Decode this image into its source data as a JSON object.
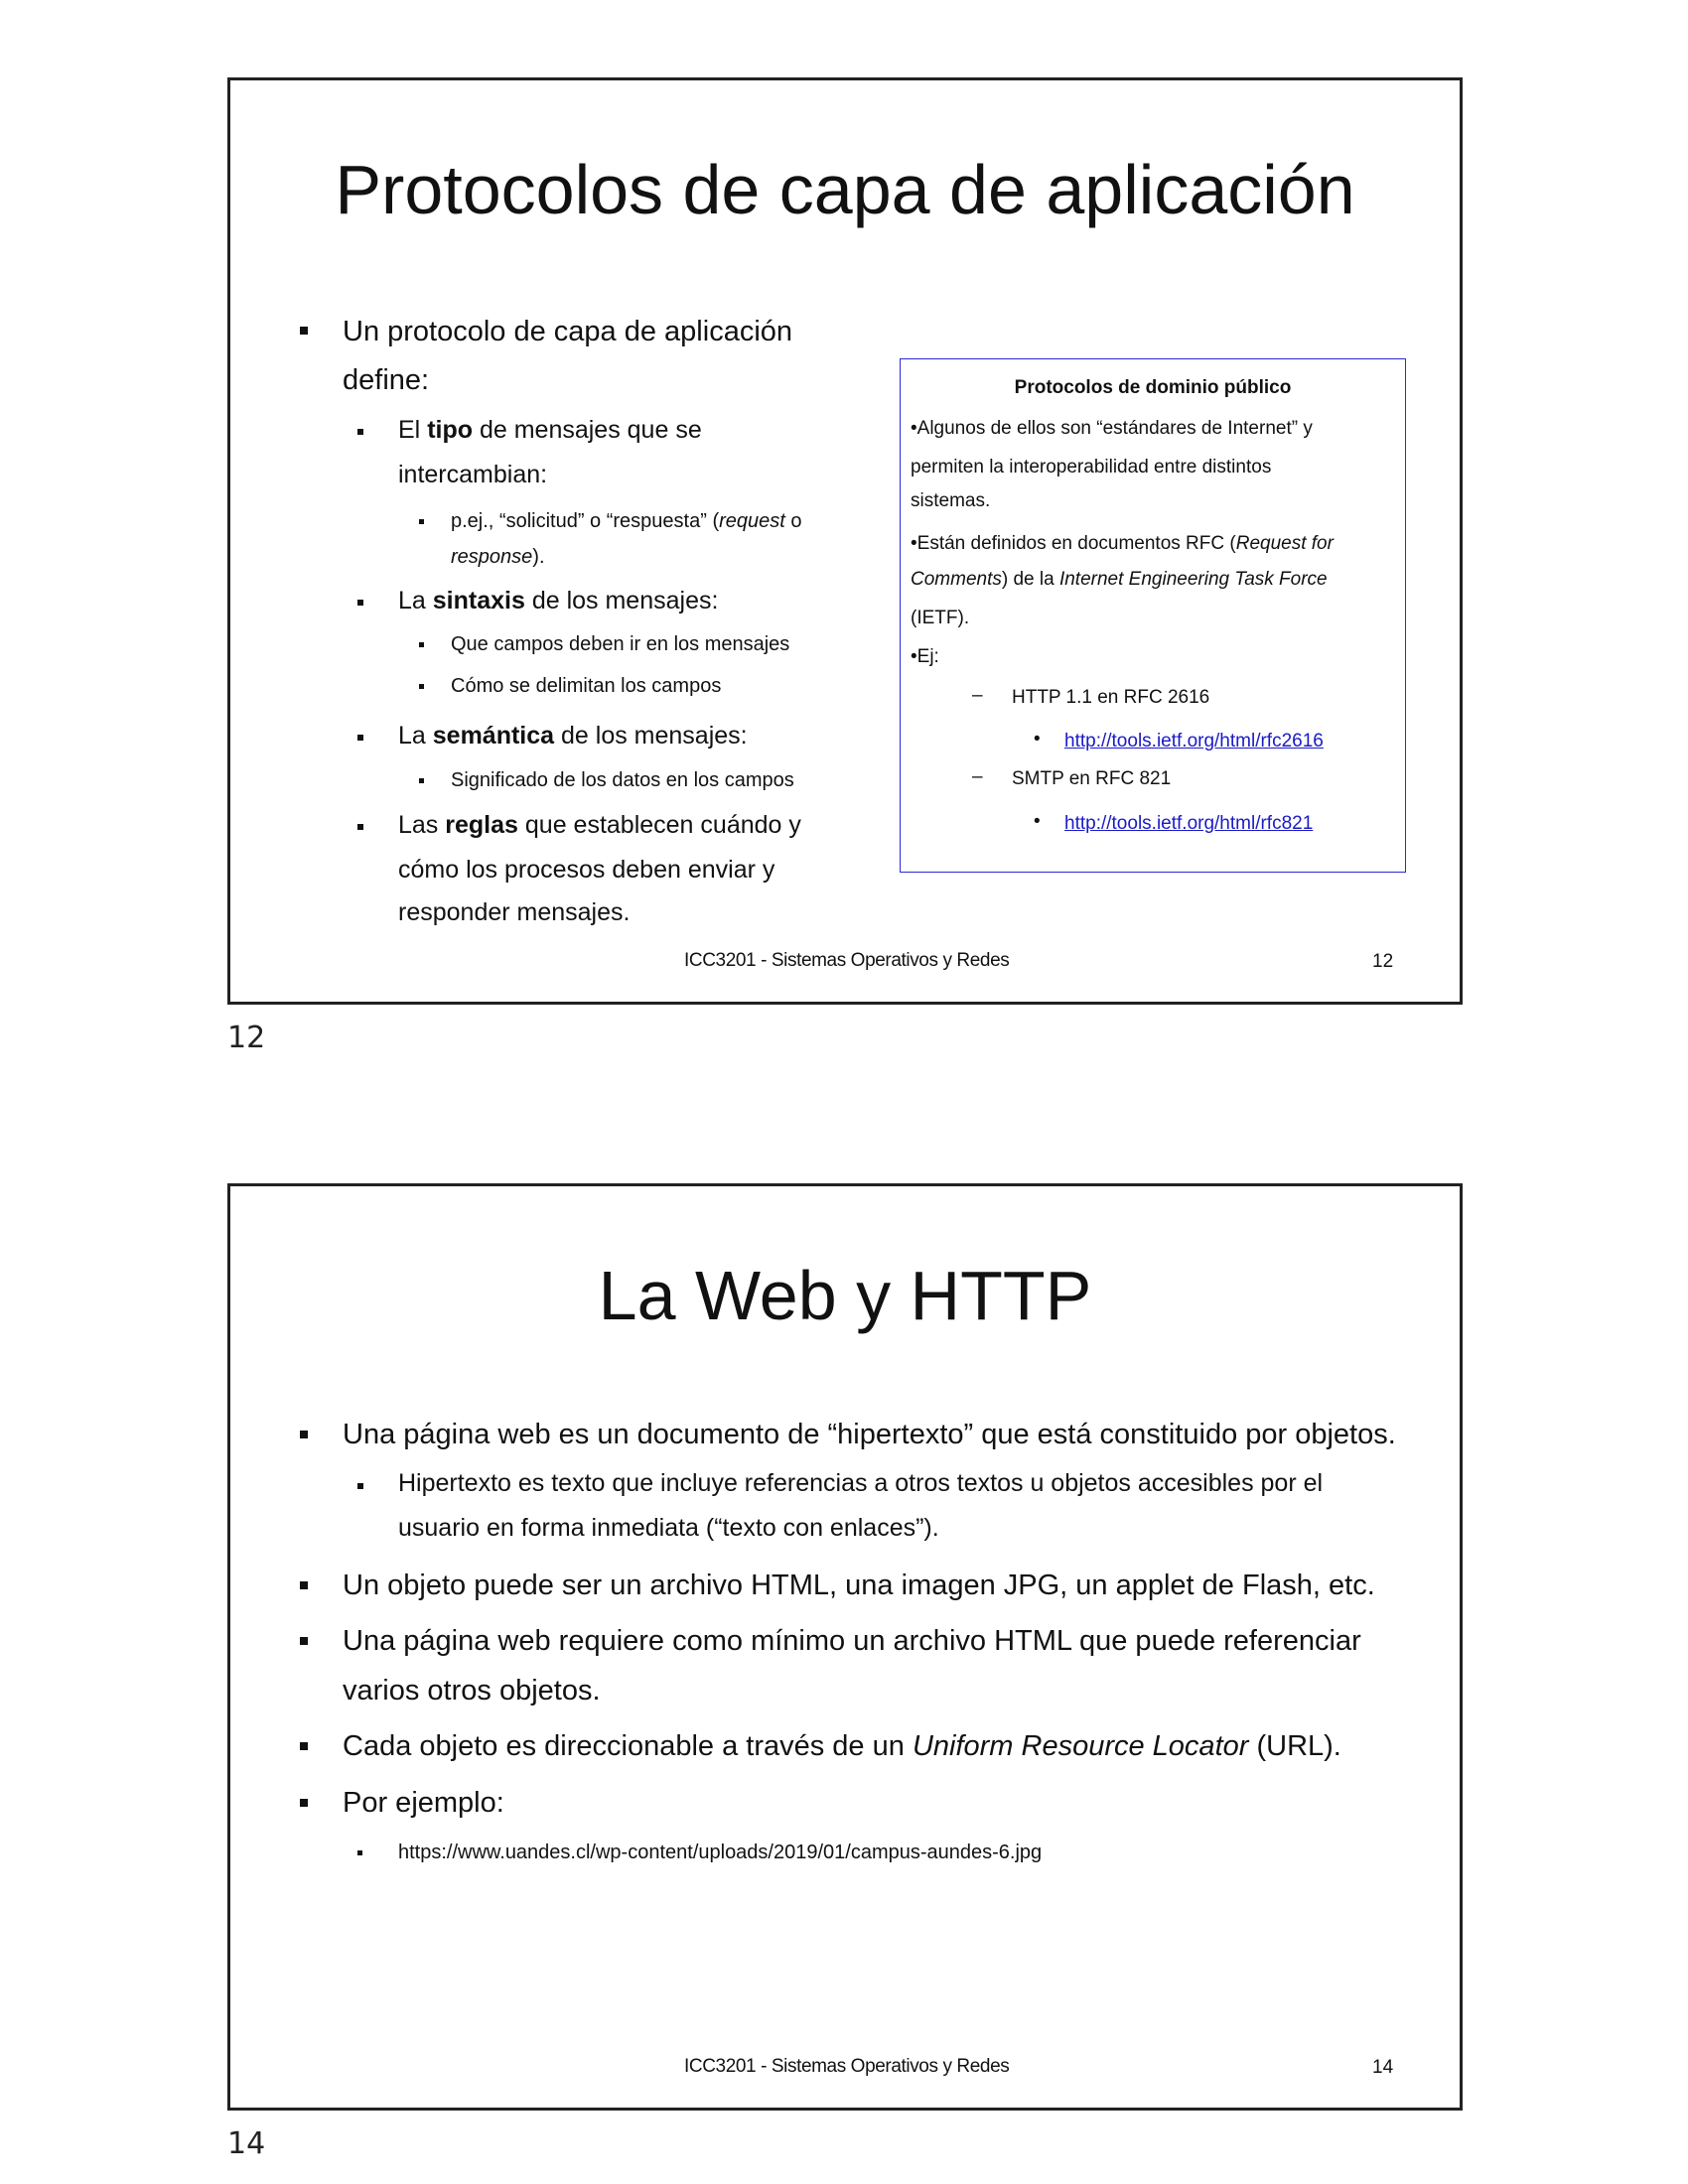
{
  "slide1": {
    "title": "Protocolos de capa de aplicación",
    "intro_line1": "Un protocolo de capa de aplicación",
    "intro_line2": "define:",
    "b1_pre": "El ",
    "b1_bold": "tipo",
    "b1_post": " de mensajes que se",
    "b1_line2": "intercambian:",
    "b1_sub_pre": "p.ej., “solicitud” o  “respuesta” (",
    "b1_sub_it": "request",
    "b1_sub_post": " o",
    "b1_sub_line2_it": "response",
    "b1_sub_line2_post": ").",
    "b2_pre": "La ",
    "b2_bold": "sintaxis",
    "b2_post": " de los mensajes:",
    "b2_sub1": "Que campos deben ir en los mensajes",
    "b2_sub2": "Cómo se delimitan los campos",
    "b3_pre": "La ",
    "b3_bold": "semántica",
    "b3_post": " de los mensajes:",
    "b3_sub1": "Significado de los datos en los campos",
    "b4_pre": "Las ",
    "b4_bold": "reglas",
    "b4_post": " que establecen cuándo y",
    "b4_line2": "cómo los procesos deben enviar y",
    "b4_line3": "responder mensajes.",
    "footer": "ICC3201 - Sistemas Operativos y Redes",
    "slide_number": "12",
    "page_number": "12",
    "box": {
      "heading": "Protocolos de dominio público",
      "line1": "•Algunos de ellos son “estándares de Internet” y",
      "line2": "permiten la interoperabilidad entre distintos",
      "line3": "sistemas.",
      "line4_pre": "•Están definidos en documentos RFC (",
      "line4_it": "Request for",
      "line5_it1": "Comments",
      "line5_mid": ") de la ",
      "line5_it2": "Internet Engineering Task Force",
      "line6": "(IETF).",
      "line7": "•Ej:",
      "dash": "–",
      "dot": "•",
      "ex1": "HTTP 1.1 en RFC 2616",
      "ex1_link": "http://tools.ietf.org/html/rfc2616",
      "ex2": "SMTP en RFC 821",
      "ex2_link": "http://tools.ietf.org/html/rfc821"
    }
  },
  "slide2": {
    "title": "La Web y HTTP",
    "b1": "Una página web es un documento de “hipertexto” que está constituido por objetos.",
    "b1_sub_line1": "Hipertexto es texto que incluye referencias a otros textos u objetos accesibles por el",
    "b1_sub_line2": "usuario en forma inmediata (“texto con enlaces”).",
    "b2": "Un objeto puede ser un archivo HTML, una imagen JPG, un applet de Flash, etc.",
    "b3_line1": "Una página web requiere como mínimo un archivo HTML que puede referenciar",
    "b3_line2": "varios otros objetos.",
    "b4_pre": "Cada objeto es direccionable a través de un ",
    "b4_it": "Uniform Resource Locator",
    "b4_post": " (URL).",
    "b5": "Por ejemplo:",
    "b5_sub": "https://www.uandes.cl/wp-content/uploads/2019/01/campus-aundes-6.jpg",
    "footer": "ICC3201 - Sistemas Operativos y Redes",
    "slide_number": "14",
    "page_number": "14"
  }
}
